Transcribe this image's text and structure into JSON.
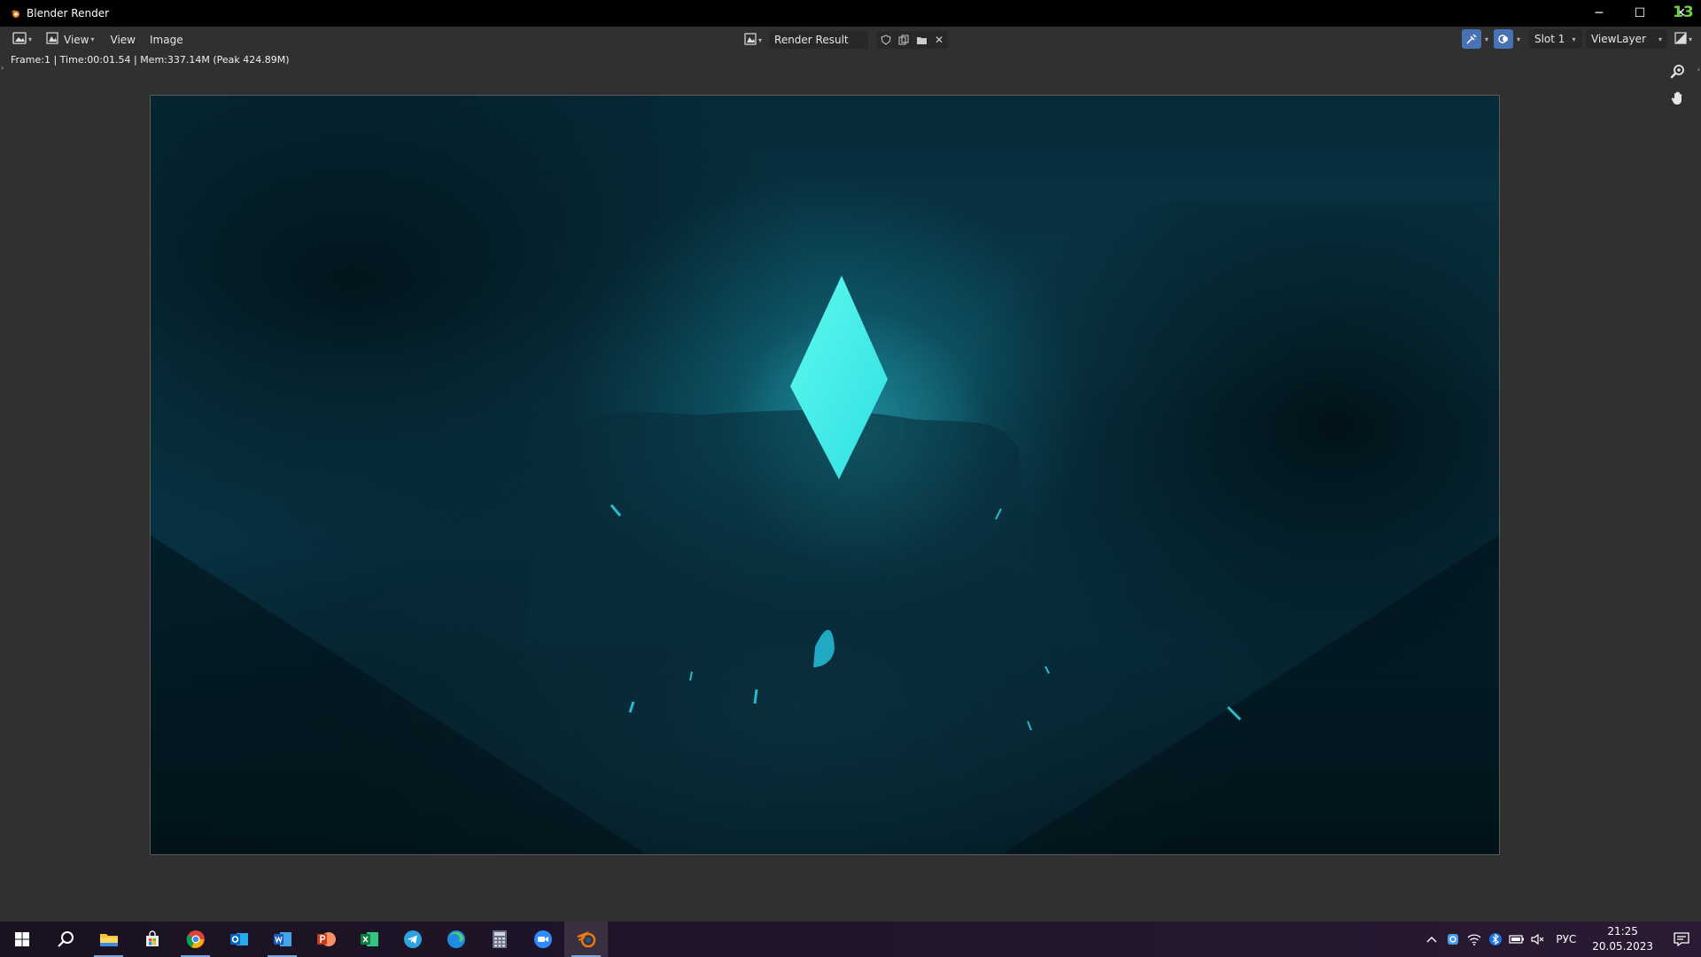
{
  "window": {
    "title": "Blender Render",
    "minimize": "─",
    "maximize": "☐",
    "close": "✕",
    "logo_text": "13"
  },
  "header": {
    "editor_type_icon": "image-editor-icon",
    "view_menu_dropdown": "View",
    "menus": [
      "View",
      "Image"
    ],
    "image_name": "Render Result",
    "slot": "Slot 1",
    "view_layer": "ViewLayer"
  },
  "info_line": "Frame:1 | Time:00:01.54 | Mem:337.14M (Peak 424.89M)",
  "taskbar": {
    "icons": [
      "windows-start-icon",
      "search-icon",
      "file-explorer-icon",
      "microsoft-store-icon",
      "chrome-icon",
      "outlook-icon",
      "word-icon",
      "powerpoint-icon",
      "excel-icon",
      "telegram-icon",
      "edge-icon",
      "calculator-icon",
      "zoom-icon",
      "blender-icon"
    ],
    "language": "РУС",
    "time": "21:25",
    "date": "20.05.2023"
  },
  "colors": {
    "crystal": "#3ff2ee",
    "accent_blue": "#7aa6da",
    "blender_orange": "#e87d0d"
  }
}
